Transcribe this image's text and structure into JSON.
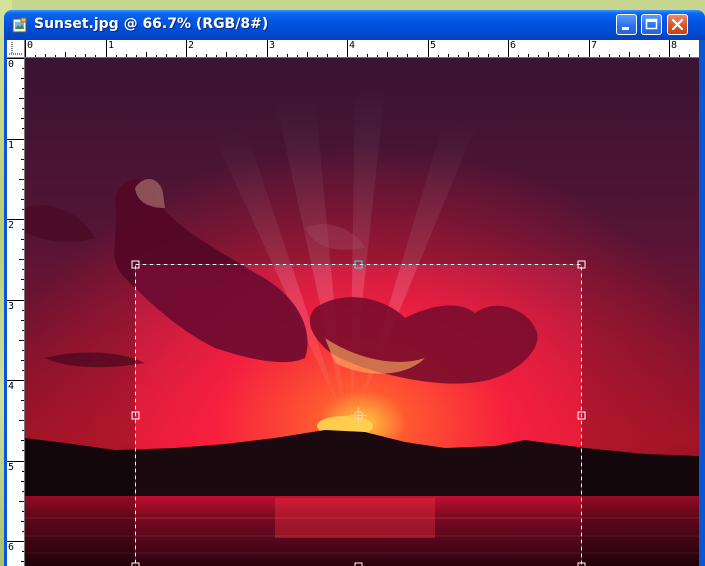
{
  "window": {
    "title": "Sunset.jpg @ 66.7% (RGB/8#)",
    "controls": [
      "minimize",
      "maximize",
      "close"
    ]
  },
  "rulers": {
    "units": "inches",
    "top_labels": [
      "0",
      "1",
      "2",
      "3",
      "4",
      "5",
      "6",
      "7",
      "8"
    ],
    "left_labels": [
      "0",
      "1",
      "2",
      "3",
      "4",
      "5",
      "6"
    ]
  },
  "canvas": {
    "image": "sunset-photo",
    "selection_marquee": "dashed rectangle with transform handles"
  },
  "colors": {
    "titlebar": "#0053e0",
    "sky_top": "#4a1a40",
    "sky_glow": "#ff2a4a",
    "sun": "#ffcc40",
    "mountains": "#1a0a10",
    "water": "#3a0818"
  }
}
